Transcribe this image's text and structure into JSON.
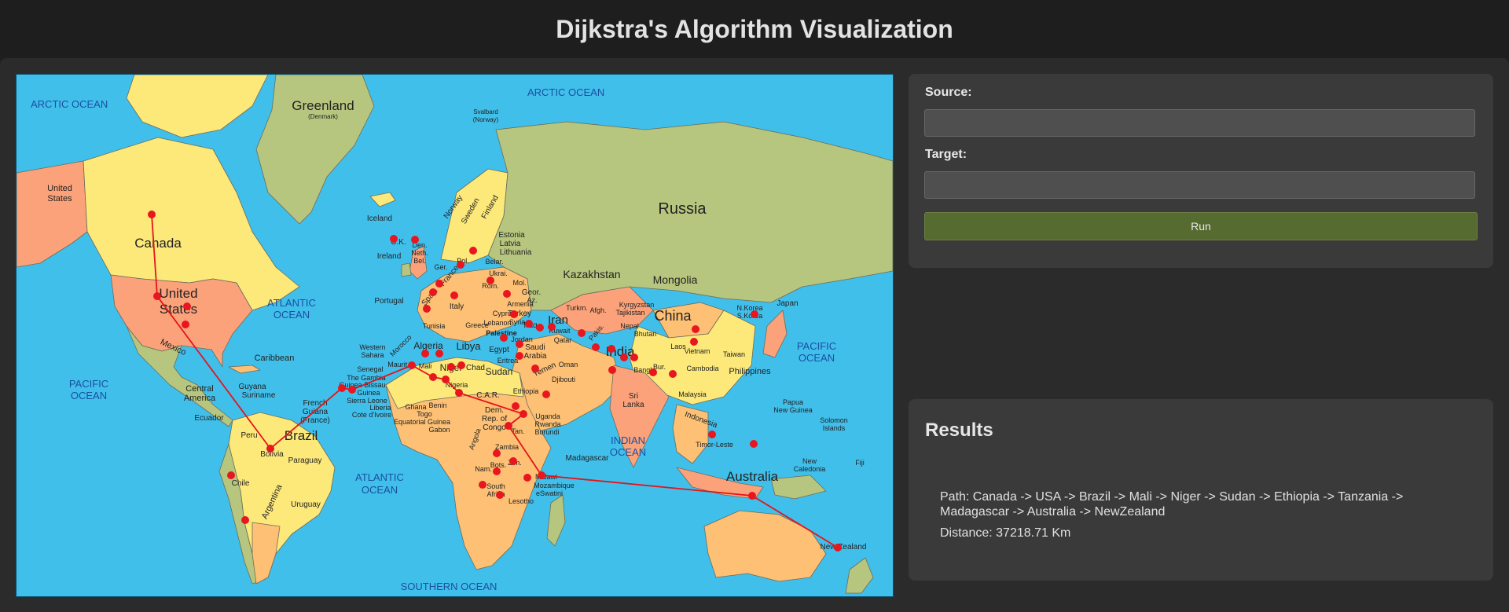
{
  "app": {
    "title": "Dijkstra's Algorithm Visualization"
  },
  "controls": {
    "source_label": "Source:",
    "source_value": "",
    "target_label": "Target:",
    "target_value": "",
    "run_label": "Run"
  },
  "results": {
    "heading": "Results",
    "path_text": "Path: Canada -> USA -> Brazil -> Mali -> Niger -> Sudan -> Ethiopia -> Tanzania -> Madagascar -> Australia -> NewZealand",
    "distance_text": "Distance: 37218.71 Km"
  },
  "map": {
    "oceans": {
      "arctic_w": "ARCTIC OCEAN",
      "arctic_e": "ARCTIC OCEAN",
      "atlantic_n1": "ATLANTIC",
      "atlantic_n2": "OCEAN",
      "atlantic_s1": "ATLANTIC",
      "atlantic_s2": "OCEAN",
      "pacific_w1": "PACIFIC",
      "pacific_w2": "OCEAN",
      "pacific_e1": "PACIFIC",
      "pacific_e2": "OCEAN",
      "indian1": "INDIAN",
      "indian2": "OCEAN",
      "southern": "SOUTHERN OCEAN"
    },
    "labels": {
      "greenland": "Greenland",
      "denmark": "(Denmark)",
      "svalbard": "Svalbard",
      "norway_paren": "(Norway)",
      "us_alaska1": "United",
      "us_alaska2": "States",
      "canada": "Canada",
      "usa1": "United",
      "usa2": "States",
      "mexico": "Mexico",
      "caribbean": "Caribbean",
      "central_america1": "Central",
      "central_america2": "America",
      "ecuador": "Ecuador",
      "peru": "Peru",
      "bolivia": "Bolivia",
      "brazil": "Brazil",
      "paraguay": "Paraguay",
      "chile": "Chile",
      "argentina": "Argentina",
      "uruguay": "Uruguay",
      "guyana": "Guyana",
      "suriname": "Suriname",
      "french_guiana1": "French",
      "french_guiana2": "Guiana",
      "french_guiana3": "(France)",
      "iceland": "Iceland",
      "uk": "U.K.",
      "ireland": "Ireland",
      "portugal": "Portugal",
      "spain": "Spain",
      "france": "France",
      "italy": "Italy",
      "norway": "Norway",
      "sweden": "Sweden",
      "finland": "Finland",
      "estonia": "Estonia",
      "latvia": "Latvia",
      "lithuania": "Lithuania",
      "belarus": "Belar.",
      "ukraine": "Ukrai.",
      "romania": "Rom.",
      "turkey": "Turkey",
      "georgia": "Geor.",
      "armenia": "Armenia",
      "russia": "Russia",
      "kazakhstan": "Kazakhstan",
      "mongolia": "Mongolia",
      "china": "China",
      "japan": "Japan",
      "nkorea": "N.Korea",
      "skorea": "S.Korea",
      "kyrgyzstan": "Kyrgyzstan",
      "tajikistan": "Tajikistan",
      "turkmen": "Turkm.",
      "iran": "Iran",
      "iraq": "Iraq",
      "syria": "Syria",
      "lebanon": "Lebanon",
      "palestine": "Palestine",
      "jordan": "Jordan",
      "kuwait": "Kuwait",
      "qatar": "Qatar",
      "saudi1": "Saudi",
      "saudi2": "Arabia",
      "yemen": "Yemen",
      "oman": "Oman",
      "pakistan": "Pakis.",
      "afghan": "Afgh.",
      "nepal": "Nepal",
      "bhutan": "Bhutan",
      "india": "India",
      "bangladesh": "Bangl.",
      "laos": "Laos",
      "vietnam": "Vietnam",
      "cambodia": "Cambodia",
      "burma": "Bur.",
      "taiwan": "Taiwan",
      "philippines": "Philippines",
      "malaysia": "Malaysia",
      "indonesia": "Indonesia",
      "sri_lanka1": "Sri",
      "sri_lanka2": "Lanka",
      "timor": "Timor-Leste",
      "papua1": "Papua",
      "papua2": "New Guinea",
      "solomon1": "Solomon",
      "solomon2": "Islands",
      "new_caledonia1": "New",
      "new_caledonia2": "Caledonia",
      "fiji": "Fiji",
      "australia": "Australia",
      "new_zealand": "New Zealand",
      "morocco": "Morocco",
      "algeria": "Algeria",
      "tunisia": "Tunisia",
      "libya": "Libya",
      "egypt": "Egypt",
      "western_sahara1": "Western",
      "western_sahara2": "Sahara",
      "mauritania": "Maurit.",
      "mali": "Mali",
      "niger": "Niger",
      "chad": "Chad",
      "sudan": "Sudan",
      "eritrea": "Eritrea",
      "ethiopia": "Ethiopia",
      "djibouti": "Djibouti",
      "senegal": "Senegal",
      "gambia": "The Gambia",
      "guinea_bissau": "Guinea-Bissau",
      "guinea": "Guinea",
      "sierra_leone": "Sierra Leone",
      "liberia": "Liberia",
      "cote": "Cote d'Ivoire",
      "ghana": "Ghana",
      "togo": "Togo",
      "benin": "Benin",
      "nigeria": "Nigeria",
      "eq_guinea": "Equatorial Guinea",
      "gabon": "Gabon",
      "car": "C.A.R.",
      "drc1": "Dem.",
      "drc2": "Rep. of",
      "drc3": "Congo",
      "uganda": "Uganda",
      "rwanda": "Rwanda",
      "burundi": "Burundi",
      "tanzania": "Tan.",
      "angola": "Angola",
      "zambia": "Zambia",
      "namibia": "Nam.",
      "botswana": "Bots.",
      "zimbabwe": "Zim.",
      "malawi": "Malawi",
      "mozambique": "Mozambique",
      "eswatini": "eSwatini",
      "lesotho": "Lesotho",
      "south_africa1": "South",
      "south_africa2": "Africa",
      "madagascar": "Madagascar",
      "greece": "Greece",
      "cyprus": "Cyprus",
      "denmark_s": "Den.",
      "neth": "Neth.",
      "bel": "Bel.",
      "ger": "Ger.",
      "pol": "Pol.",
      "mol": "Mol.",
      "azer": "Az."
    },
    "colors": {
      "ocean": "#41bfeb",
      "land_yellow": "#fde97a",
      "land_green": "#b6c67e",
      "land_salmon": "#fba27a",
      "land_orange": "#fdc074",
      "land_grey": "#d2d2ba",
      "border": "#6b6b5a",
      "route": "#e4141b",
      "node": "#e8161e"
    }
  }
}
